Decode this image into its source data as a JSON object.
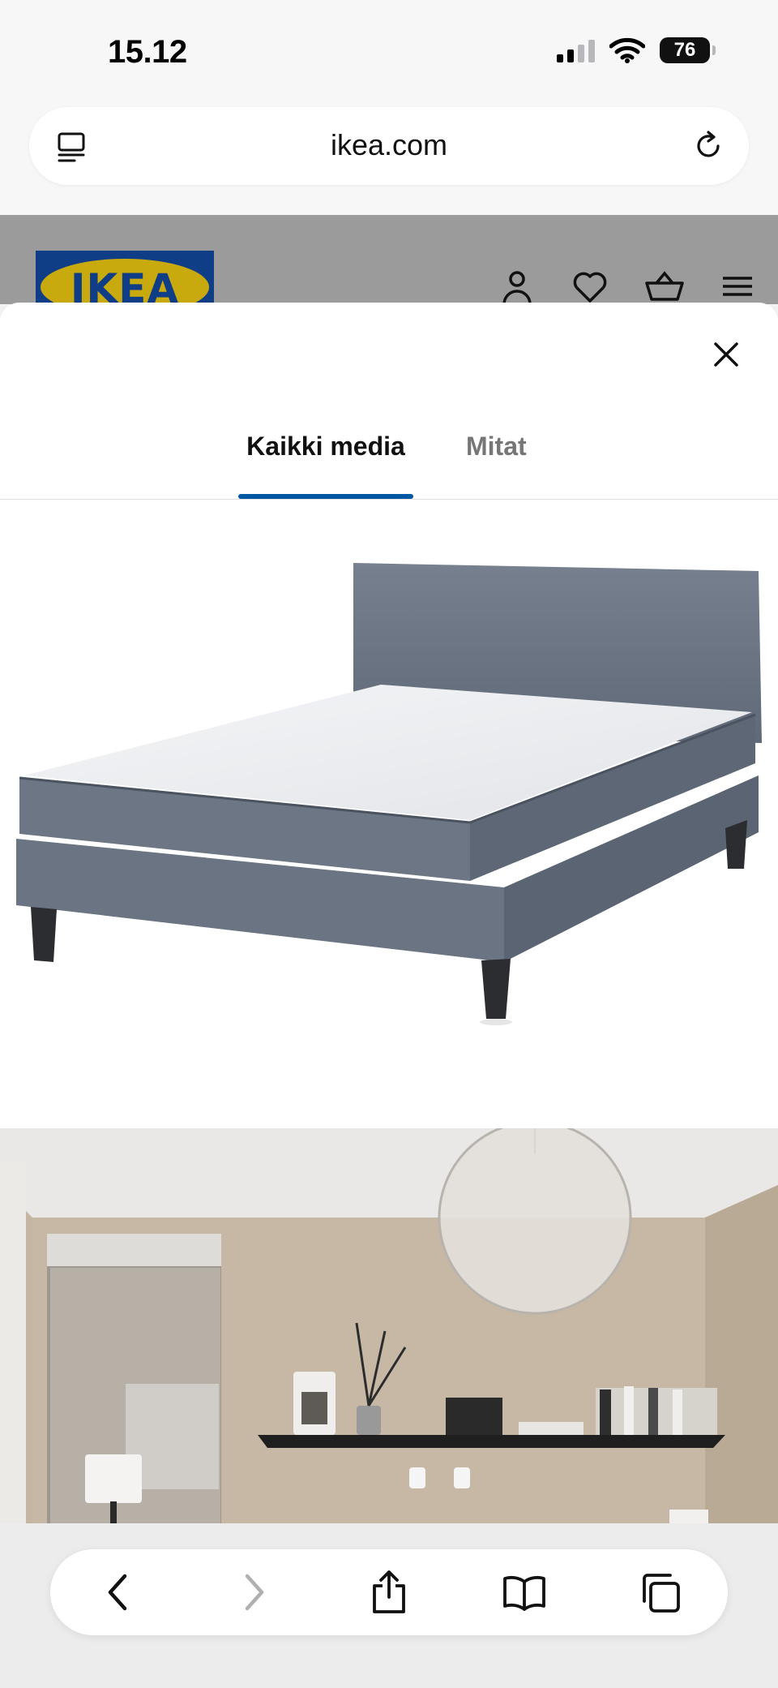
{
  "status_bar": {
    "time": "15.12",
    "battery": "76",
    "icons": [
      "cellular-signal-icon",
      "wifi-icon",
      "battery-icon"
    ]
  },
  "browser": {
    "url": "ikea.com",
    "icons": [
      "reader-icon",
      "reload-icon"
    ]
  },
  "site_header": {
    "logo_text": "IKEA",
    "icons": [
      "account-icon",
      "favorites-heart-icon",
      "shopping-basket-icon",
      "menu-icon"
    ],
    "colors": {
      "logo_blue": "#0f3d86",
      "logo_yellow": "#c8a90e"
    }
  },
  "media_modal": {
    "tabs": [
      {
        "label": "Kaikki media",
        "active": true
      },
      {
        "label": "Mitat",
        "active": false
      }
    ],
    "accent_color": "#0058a3",
    "images": [
      {
        "name": "product-image-bed"
      },
      {
        "name": "room-image-bedroom"
      }
    ]
  },
  "toolbar": {
    "icons": [
      "back-icon",
      "forward-icon",
      "share-icon",
      "bookmarks-icon",
      "tabs-icon"
    ],
    "forward_enabled": false
  }
}
